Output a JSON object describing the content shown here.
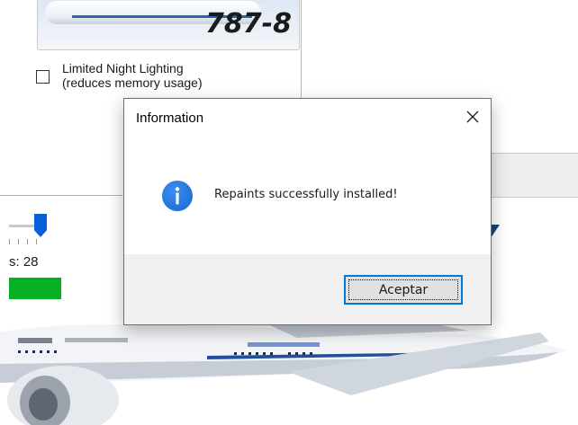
{
  "background": {
    "aircraft_model": "787-8",
    "night_lighting": {
      "label_line1": "Limited Night Lighting",
      "label_line2": "(reduces memory usage)",
      "checked": false
    },
    "slider_value_text": "s: 28",
    "progress_percent": 100
  },
  "dialog": {
    "title": "Information",
    "message": "Repaints successfully installed!",
    "ok_label": "Aceptar",
    "icon": "info-icon"
  },
  "colors": {
    "accent": "#0078d7",
    "progress_green": "#06b025",
    "info_blue": "#1a73e0"
  }
}
